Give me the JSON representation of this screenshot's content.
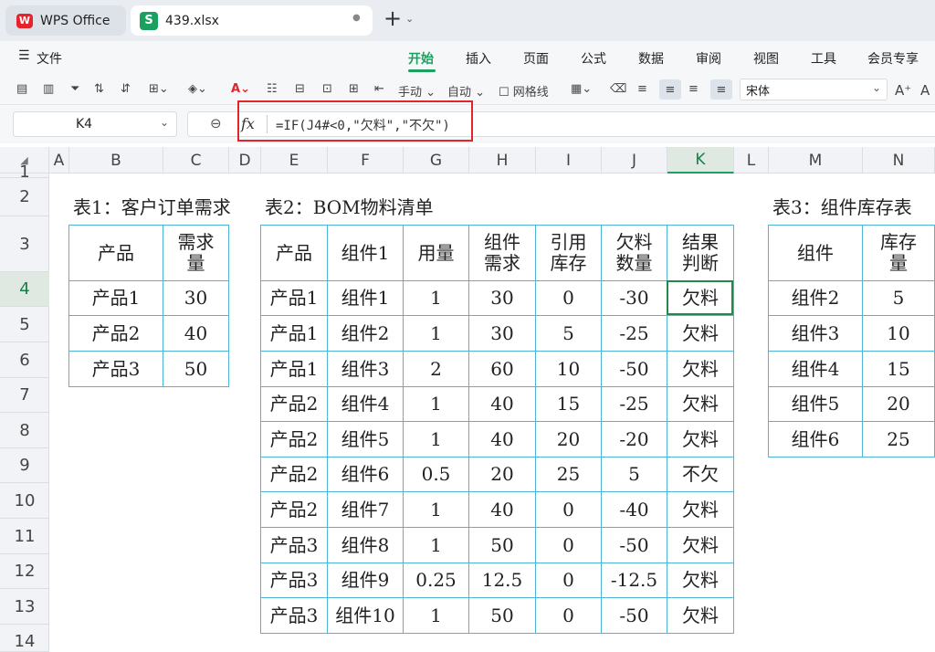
{
  "app": {
    "name": "WPS Office",
    "file_tab": "439.xlsx",
    "file_menu": "文件",
    "ribbon_tabs": [
      "开始",
      "插入",
      "页面",
      "公式",
      "数据",
      "审阅",
      "视图",
      "工具",
      "会员专享"
    ],
    "active_tab": "开始"
  },
  "toolbar": {
    "fill_label": "手动",
    "auto_label": "自动",
    "gridlines_label": "网格线",
    "font_name": "宋体"
  },
  "formula_bar": {
    "cell_ref": "K4",
    "fx_label": "fx",
    "formula": "=IF(J4#<0,\"欠料\",\"不欠\")"
  },
  "columns": [
    "A",
    "B",
    "C",
    "D",
    "E",
    "F",
    "G",
    "H",
    "I",
    "J",
    "K",
    "L",
    "M",
    "N"
  ],
  "rows": [
    "1",
    "2",
    "3",
    "4",
    "5",
    "6",
    "7",
    "8",
    "9",
    "10",
    "11",
    "12",
    "13",
    "14"
  ],
  "table1": {
    "caption": "表1：客户订单需求",
    "headers": [
      "产品",
      "需求\n量"
    ],
    "rows": [
      [
        "产品1",
        "30"
      ],
      [
        "产品2",
        "40"
      ],
      [
        "产品3",
        "50"
      ]
    ]
  },
  "table2": {
    "caption": "表2：BOM物料清单",
    "headers": [
      "产品",
      "组件1",
      "用量",
      "组件\n需求",
      "引用\n库存",
      "欠料\n数量",
      "结果\n判断"
    ],
    "rows": [
      [
        "产品1",
        "组件1",
        "1",
        "30",
        "0",
        "-30",
        "欠料"
      ],
      [
        "产品1",
        "组件2",
        "1",
        "30",
        "5",
        "-25",
        "欠料"
      ],
      [
        "产品1",
        "组件3",
        "2",
        "60",
        "10",
        "-50",
        "欠料"
      ],
      [
        "产品2",
        "组件4",
        "1",
        "40",
        "15",
        "-25",
        "欠料"
      ],
      [
        "产品2",
        "组件5",
        "1",
        "40",
        "20",
        "-20",
        "欠料"
      ],
      [
        "产品2",
        "组件6",
        "0.5",
        "20",
        "25",
        "5",
        "不欠"
      ],
      [
        "产品2",
        "组件7",
        "1",
        "40",
        "0",
        "-40",
        "欠料"
      ],
      [
        "产品3",
        "组件8",
        "1",
        "50",
        "0",
        "-50",
        "欠料"
      ],
      [
        "产品3",
        "组件9",
        "0.25",
        "12.5",
        "0",
        "-12.5",
        "欠料"
      ],
      [
        "产品3",
        "组件10",
        "1",
        "50",
        "0",
        "-50",
        "欠料"
      ]
    ]
  },
  "table3": {
    "caption": "表3：组件库存表",
    "headers": [
      "组件",
      "库存\n量"
    ],
    "rows": [
      [
        "组件2",
        "5"
      ],
      [
        "组件3",
        "10"
      ],
      [
        "组件4",
        "15"
      ],
      [
        "组件5",
        "20"
      ],
      [
        "组件6",
        "25"
      ]
    ]
  },
  "colors": {
    "accent": "#1aa15f",
    "table_border": "#4fb5d8",
    "highlight_box": "#e0252b",
    "wps_red": "#e8222b"
  }
}
